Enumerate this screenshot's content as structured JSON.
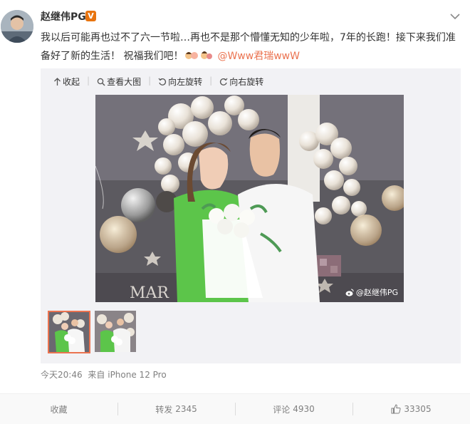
{
  "post": {
    "username": "赵继伟PG",
    "verified_mark": "V",
    "text": "我以后可能再也过不了六一节啦…再也不是那个懵懂无知的少年啦，7年的长跑！接下来我们准备好了新的生活！ 祝福我们吧！",
    "mention": "@Www君瑞wwW",
    "timestamp": "今天20:46",
    "source": "来自 iPhone 12 Pro"
  },
  "media": {
    "toolbar": {
      "collapse": "收起",
      "view_large": "查看大图",
      "rotate_left": "向左旋转",
      "rotate_right": "向右旋转"
    },
    "watermark": "@赵继伟PG",
    "photo_text": "MAR"
  },
  "footer": {
    "favorite": "收藏",
    "repost_label": "转发",
    "repost_count": "2345",
    "comment_label": "评论",
    "comment_count": "4930",
    "like_count": "33305"
  },
  "colors": {
    "accent": "#eb7350",
    "verified": "#e8740f",
    "muted": "#808080"
  }
}
